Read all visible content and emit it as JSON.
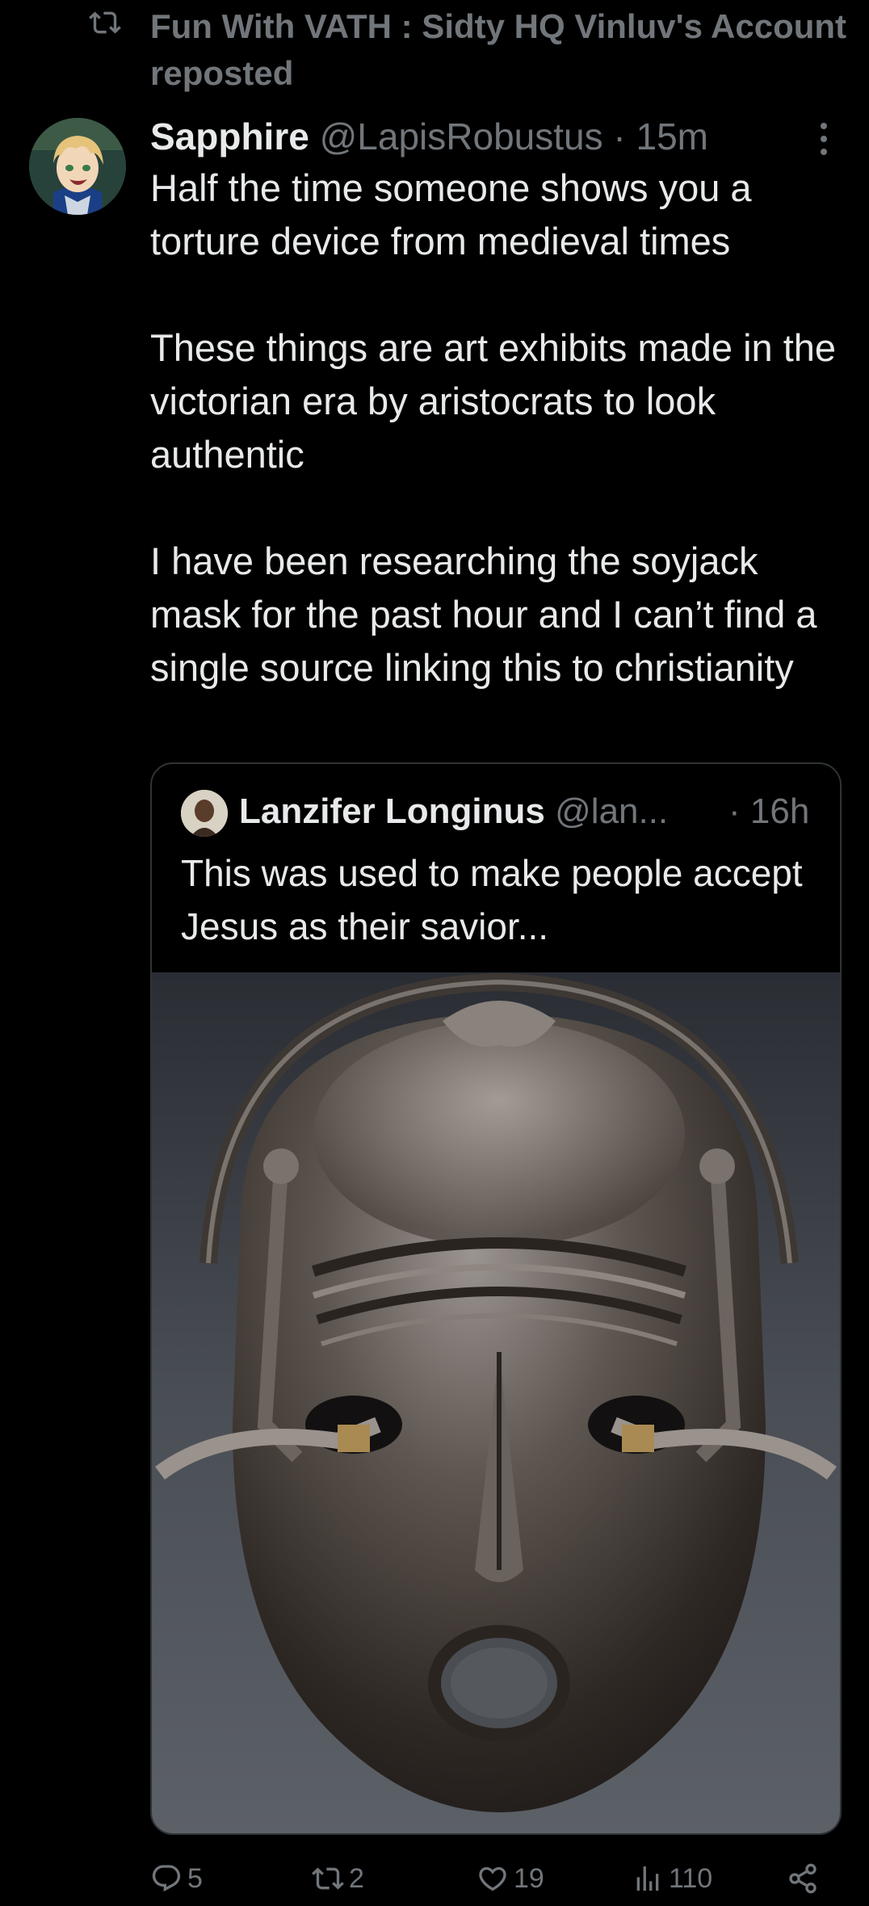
{
  "repost": {
    "text": "Fun With VATH : Sidty HQ Vinluv's Account reposted"
  },
  "tweet": {
    "display_name": "Sapphire",
    "handle": "@LapisRobustus",
    "separator": "·",
    "time": "15m",
    "paragraphs": [
      "Half the time someone shows you a torture device from medieval times",
      "These things are art exhibits made in the victorian era by aristocrats to look authentic",
      "I have been researching the soyjack mask for the past hour and I can’t find a single source linking this to christianity"
    ]
  },
  "quote": {
    "display_name": "Lanzifer Longinus",
    "handle": "@lan...",
    "time": "· 16h",
    "text": "This was used to make people accept Jesus as their savior..."
  },
  "actions": {
    "replies": "5",
    "reposts": "2",
    "likes": "19",
    "views": "110"
  },
  "icons": {
    "repost": "repost-icon",
    "more": "more-icon",
    "reply": "reply-icon",
    "like": "heart-icon",
    "views": "views-icon",
    "share": "share-icon"
  },
  "colors": {
    "background": "#000000",
    "text_primary": "#e7e9ea",
    "text_secondary": "#71767b",
    "border": "#2f3336"
  }
}
